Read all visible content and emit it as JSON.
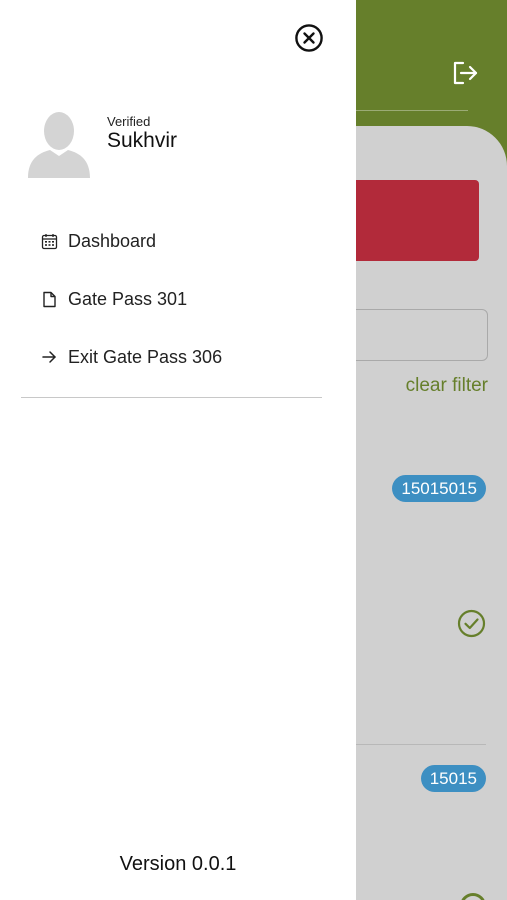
{
  "background": {
    "header_color": "#667f2b",
    "logout_icon": "logout-icon",
    "clear_filter_label": "clear filter",
    "badges": [
      "15015015",
      "15015"
    ],
    "check_icon": "check-circle-icon",
    "red_button_color": "#b22a3a",
    "badge_color": "#3d8fc2"
  },
  "drawer": {
    "close_icon": "close-circle-icon",
    "user": {
      "status": "Verified",
      "name": "Sukhvir",
      "avatar_icon": "avatar-icon"
    },
    "menu": [
      {
        "label": "Dashboard",
        "icon": "calendar-icon"
      },
      {
        "label": "Gate Pass 301",
        "icon": "document-icon"
      },
      {
        "label": "Exit Gate Pass 306",
        "icon": "arrow-right-icon"
      }
    ],
    "version": "Version 0.0.1"
  }
}
